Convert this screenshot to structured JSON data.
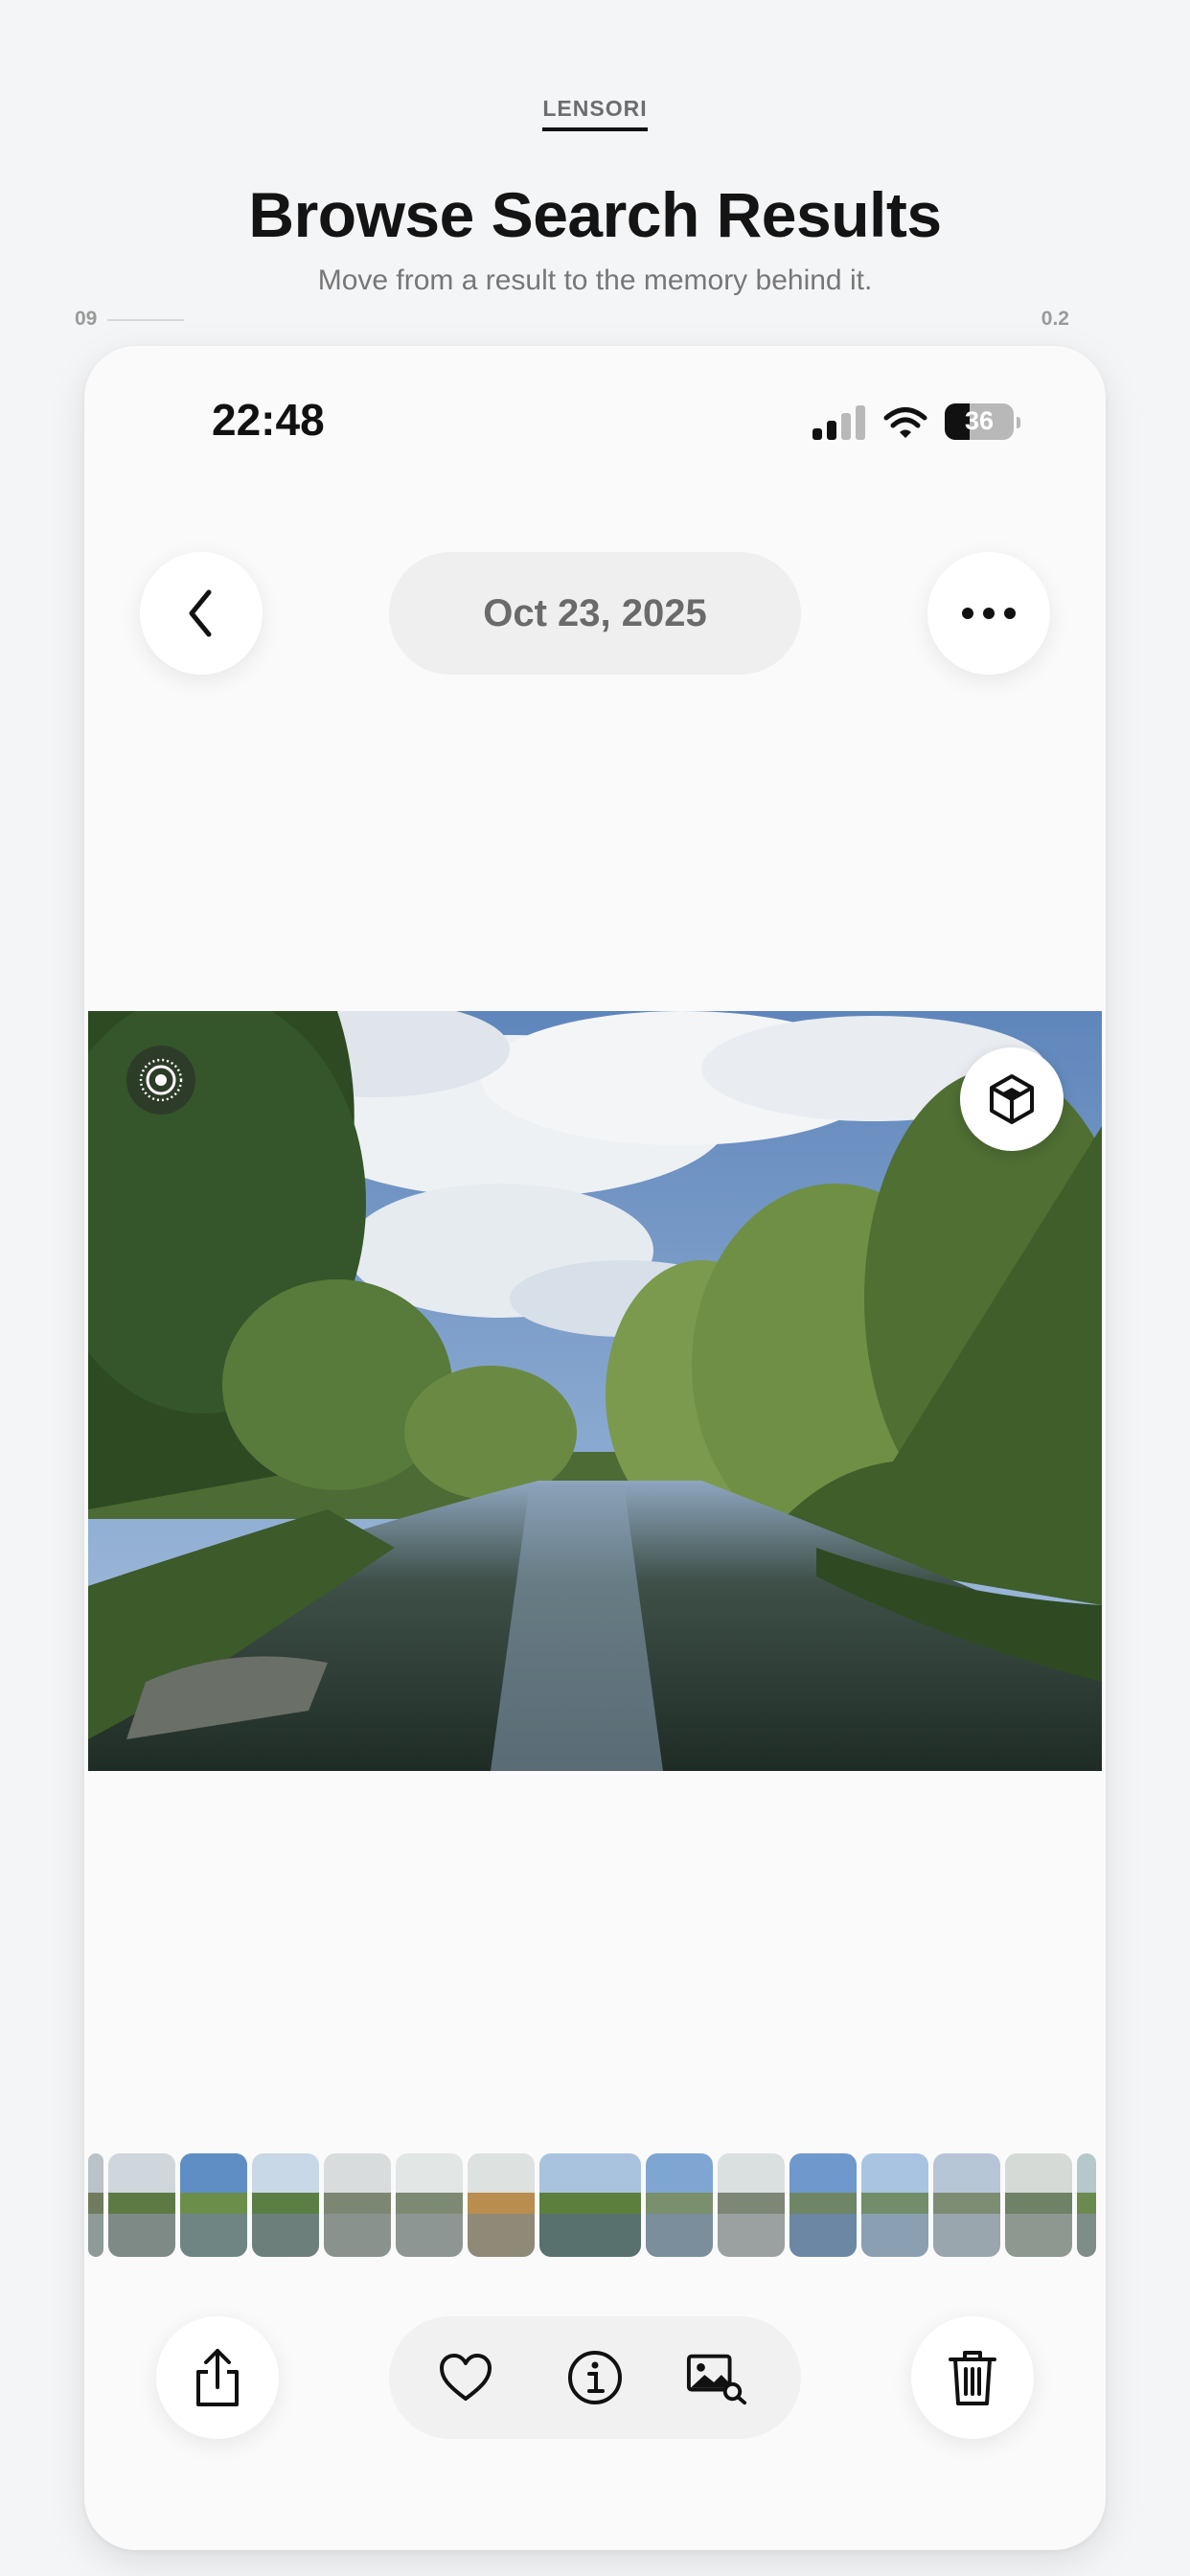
{
  "header": {
    "brand": "LENSORI",
    "title": "Browse Search Results",
    "subtitle": "Move from a result to the memory behind it.",
    "meta_left": "09",
    "meta_right": "0.2"
  },
  "status_bar": {
    "time": "22:48",
    "battery_percent": "36",
    "battery_level": 0.36,
    "signal_bars_filled": 2,
    "signal_bars_total": 4
  },
  "nav": {
    "back_icon": "chevron-left-icon",
    "date": "Oct 23, 2025",
    "more_icon": "ellipsis-icon"
  },
  "photo": {
    "live_icon": "live-photo-icon",
    "spatial_icon": "cube-icon"
  },
  "filmstrip": {
    "thumbnails": [
      {
        "sky": "#b9c3c8",
        "trees": "#6f7d5e",
        "water": "#8f9a98"
      },
      {
        "sky": "#cfd7dc",
        "trees": "#5d7a45",
        "water": "#7e8a86"
      },
      {
        "sky": "#5f8ec4",
        "trees": "#6c8e4b",
        "water": "#6f8583"
      },
      {
        "sky": "#c9d8e6",
        "trees": "#5b7e45",
        "water": "#6d7f7b"
      },
      {
        "sky": "#d9dcdc",
        "trees": "#7c8773",
        "water": "#8a928e"
      },
      {
        "sky": "#e2e6e5",
        "trees": "#7d8a73",
        "water": "#8e9693"
      },
      {
        "sky": "#dde1e0",
        "trees": "#b98d4e",
        "water": "#8f8a78"
      },
      {
        "sky": "#a9c3de",
        "trees": "#5d7f3e",
        "water": "#58706e"
      },
      {
        "sky": "#7fa6d2",
        "trees": "#7a8f6c",
        "water": "#7b8e9c"
      },
      {
        "sky": "#dadfe0",
        "trees": "#7c8775",
        "water": "#9aa1a0"
      },
      {
        "sky": "#6f98cc",
        "trees": "#6f8666",
        "water": "#6b87a3"
      },
      {
        "sky": "#a8c4e0",
        "trees": "#738d6a",
        "water": "#8aa0b2"
      },
      {
        "sky": "#b7c6d6",
        "trees": "#7d8d74",
        "water": "#9aa6ad"
      },
      {
        "sky": "#d5dad6",
        "trees": "#6f8265",
        "water": "#8d9891"
      },
      {
        "sky": "#b6c8c9",
        "trees": "#6b8a4e",
        "water": "#7d8e88"
      }
    ]
  },
  "toolbar": {
    "share_icon": "share-icon",
    "favorite_icon": "heart-icon",
    "info_icon": "info-icon",
    "visual_search_icon": "image-search-icon",
    "delete_icon": "trash-icon"
  }
}
